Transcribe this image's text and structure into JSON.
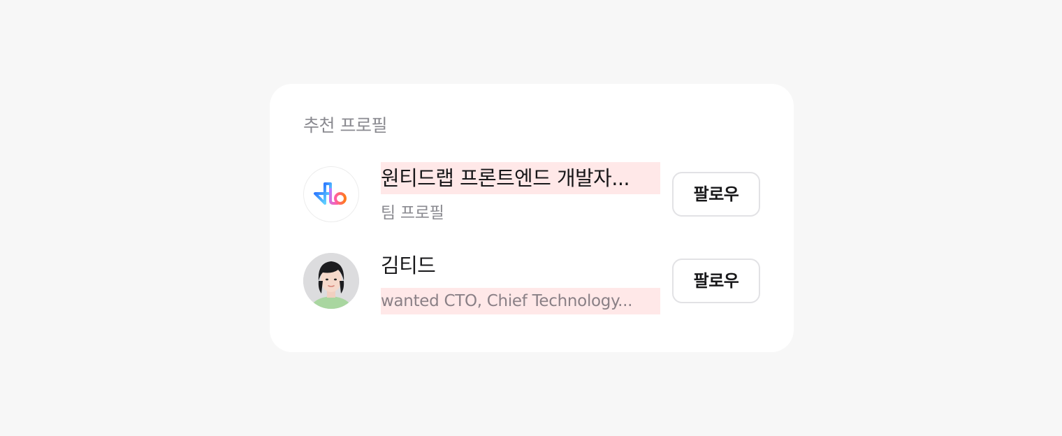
{
  "section": {
    "title": "추천 프로필"
  },
  "profiles": [
    {
      "name": "원티드랩 프론트엔드 개발자...",
      "description": "팀 프로필",
      "avatar": "wanted-logo-icon",
      "follow_label": "팔로우"
    },
    {
      "name": "김티드",
      "description": "wanted CTO, Chief Technology...",
      "avatar": "person-photo",
      "follow_label": "팔로우"
    }
  ],
  "colors": {
    "background": "#f7f7f7",
    "card": "#ffffff",
    "highlight": "#ffe8e8",
    "text_primary": "#171719",
    "text_secondary": "#8a8a90",
    "button_border": "#e2e2e5"
  }
}
